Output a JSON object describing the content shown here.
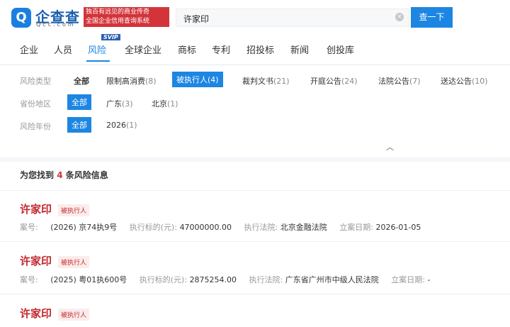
{
  "header": {
    "logo_text": "企查查",
    "logo_sub": "Qcc.com",
    "banner_line1": "独百有远见的商业传奇",
    "banner_line2": "全国企业信用查询系统",
    "search_value": "许家印",
    "search_button": "查一下"
  },
  "nav": {
    "items": [
      "企业",
      "人员",
      "风险",
      "全球企业",
      "商标",
      "专利",
      "招投标",
      "新闻",
      "创投库"
    ],
    "badge": "SVIP"
  },
  "filters": {
    "type_label": "风险类型",
    "types": [
      {
        "label": "全部",
        "count": ""
      },
      {
        "label": "限制高消费",
        "count": "(8)"
      },
      {
        "label": "被执行人",
        "count": "(4)"
      },
      {
        "label": "裁判文书",
        "count": "(21)"
      },
      {
        "label": "开庭公告",
        "count": "(24)"
      },
      {
        "label": "法院公告",
        "count": "(7)"
      },
      {
        "label": "送达公告",
        "count": "(10)"
      }
    ],
    "region_label": "省份地区",
    "regions": [
      {
        "label": "全部",
        "count": ""
      },
      {
        "label": "广东",
        "count": "(3)"
      },
      {
        "label": "北京",
        "count": "(1)"
      }
    ],
    "year_label": "风险年份",
    "years": [
      {
        "label": "全部",
        "count": ""
      },
      {
        "label": "2026",
        "count": "(1)"
      }
    ]
  },
  "result": {
    "prefix": "为您找到",
    "count": "4",
    "suffix": "条风险信息",
    "items": [
      {
        "name": "许家印",
        "tag": "被执行人",
        "case_label": "案号:",
        "case_no": "(2026) 京74执9号",
        "amount_label": "执行标的(元):",
        "amount": "47000000.00",
        "court_label": "执行法院:",
        "court": "北京金融法院",
        "date_label": "立案日期:",
        "date": "2026-01-05"
      },
      {
        "name": "许家印",
        "tag": "被执行人",
        "case_label": "案号:",
        "case_no": "(2025) 粤01执600号",
        "amount_label": "执行标的(元):",
        "amount": "2875254.00",
        "court_label": "执行法院:",
        "court": "广东省广州市中级人民法院",
        "date_label": "立案日期:",
        "date": "-"
      },
      {
        "name": "许家印",
        "tag": "被执行人"
      }
    ]
  }
}
